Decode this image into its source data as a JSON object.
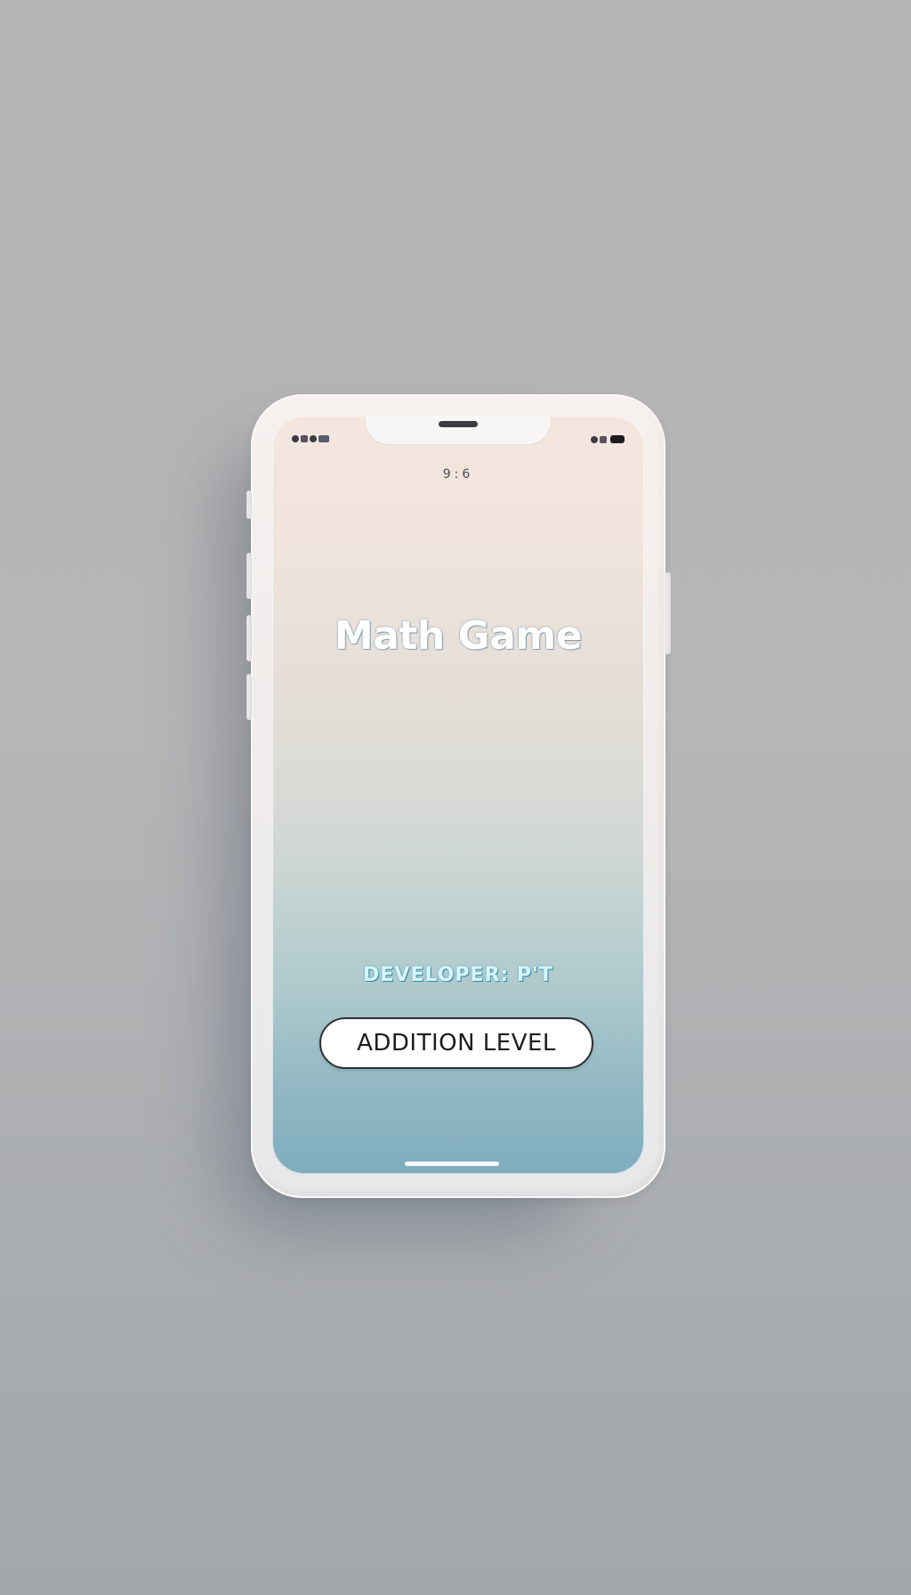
{
  "app": {
    "title": "Math Game",
    "developer_credit": "DEVELOPER: P'T",
    "primary_button_label": "ADDITION LEVEL"
  },
  "status_bar": {
    "time": "9:6",
    "left_icons": [
      "signal-icon",
      "wifi-icon",
      "location-icon",
      "camera-icon"
    ],
    "right_icons": [
      "network-icon",
      "wifi-icon",
      "battery-icon"
    ]
  },
  "colors": {
    "background": "#b5b3b4",
    "phone_body": "#f1eded",
    "screen_top": "#f4e6de",
    "screen_bottom": "#7fadbe",
    "title_text": "#ffffff",
    "developer_text": "#d6f6fb",
    "button_background": "#ffffff",
    "button_border": "#2d3033"
  }
}
